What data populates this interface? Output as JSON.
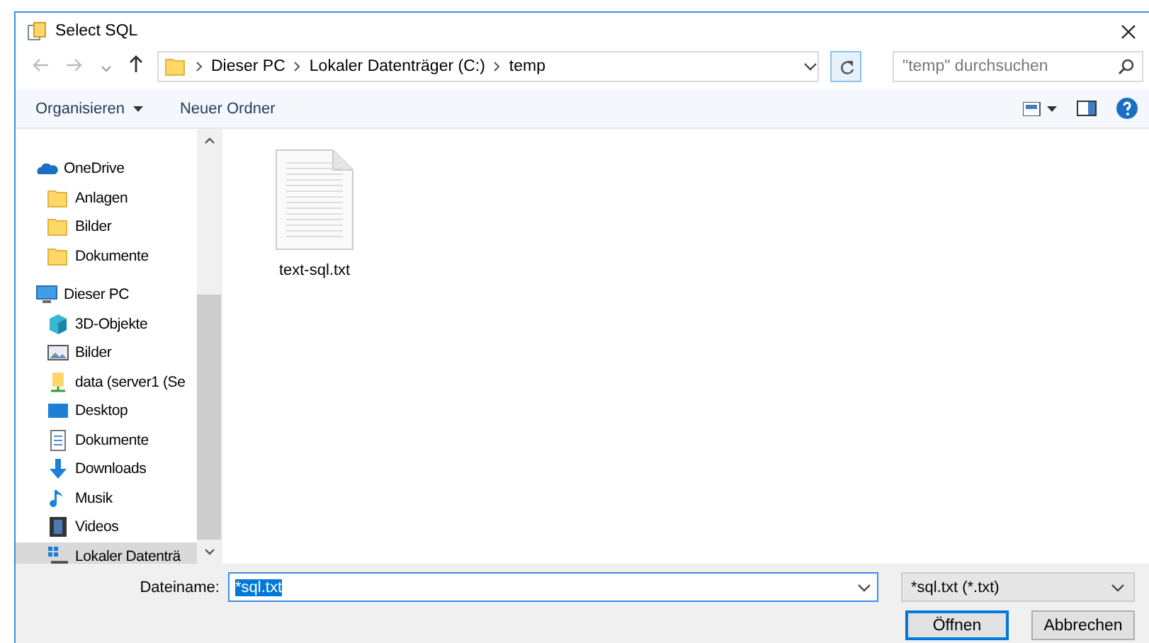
{
  "window": {
    "title": "Select SQL"
  },
  "address": {
    "path": [
      {
        "label": "Dieser PC"
      },
      {
        "label": "Lokaler Datenträger (C:)"
      },
      {
        "label": "temp"
      }
    ]
  },
  "search": {
    "placeholder": "\"temp\" durchsuchen"
  },
  "toolbar": {
    "organize": "Organisieren",
    "new_folder": "Neuer Ordner"
  },
  "sidebar": {
    "items": [
      {
        "label": "OneDrive",
        "kind": "cloud",
        "selected": false,
        "children": [
          {
            "label": "Anlagen",
            "kind": "folder",
            "selected": false
          },
          {
            "label": "Bilder",
            "kind": "folder",
            "selected": false
          },
          {
            "label": "Dokumente",
            "kind": "folder",
            "selected": false
          }
        ]
      },
      {
        "label": "Dieser PC",
        "kind": "pc",
        "selected": false,
        "children": [
          {
            "label": "3D-Objekte",
            "kind": "cube",
            "selected": false
          },
          {
            "label": "Bilder",
            "kind": "pictures",
            "selected": false
          },
          {
            "label": "data (server1 (Se",
            "kind": "netdrive",
            "selected": false
          },
          {
            "label": "Desktop",
            "kind": "desktop",
            "selected": false
          },
          {
            "label": "Dokumente",
            "kind": "document",
            "selected": false
          },
          {
            "label": "Downloads",
            "kind": "download",
            "selected": false
          },
          {
            "label": "Musik",
            "kind": "music",
            "selected": false
          },
          {
            "label": "Videos",
            "kind": "video",
            "selected": false
          },
          {
            "label": "Lokaler Datenträ",
            "kind": "drive",
            "selected": true
          }
        ]
      }
    ]
  },
  "files": [
    {
      "name": "text-sql.txt",
      "selected": false
    }
  ],
  "footer": {
    "filename_label": "Dateiname:",
    "filename": "*sql.txt",
    "filter": "*sql.txt (*.txt)",
    "open": "Öffnen",
    "cancel": "Abbrechen"
  }
}
